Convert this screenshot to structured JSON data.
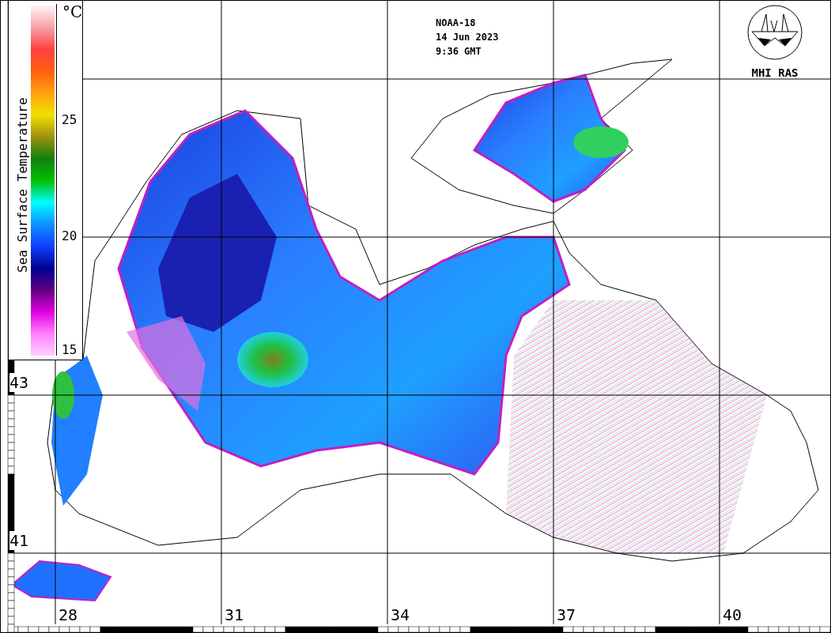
{
  "legend": {
    "title": "Sea Surface Temperature",
    "unit": "°C",
    "ticks": [
      "25",
      "20",
      "15"
    ]
  },
  "header": {
    "satellite": "NOAA-18",
    "date": "14 Jun 2023",
    "time": "9:36 GMT"
  },
  "logo": {
    "label": "MHI RAS"
  },
  "latitude_labels": [
    "43",
    "41"
  ],
  "longitude_labels": [
    "28",
    "31",
    "34",
    "37",
    "40"
  ]
}
